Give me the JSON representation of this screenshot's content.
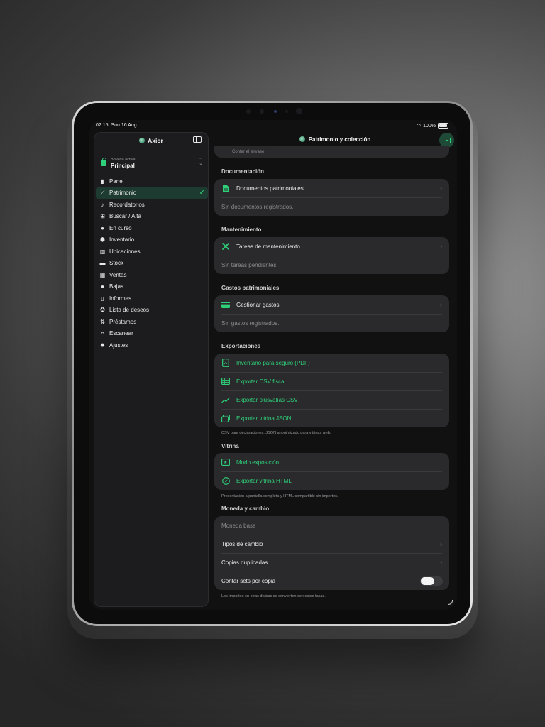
{
  "status": {
    "time": "02:15",
    "date": "Sun 16 Aug",
    "battery": "100%"
  },
  "sidebar": {
    "title": "Axior",
    "vault_label": "Bóveda activa",
    "vault_name": "Principal",
    "items": [
      {
        "label": "Panel",
        "icon": "chart-bar-icon"
      },
      {
        "label": "Patrimonio",
        "icon": "line-chart-icon",
        "active": true
      },
      {
        "label": "Recordatorios",
        "icon": "bell-icon"
      },
      {
        "label": "Buscar / Alta",
        "icon": "grid-icon"
      },
      {
        "label": "En curso",
        "icon": "progress-circle-icon"
      },
      {
        "label": "Inventario",
        "icon": "cube-icon"
      },
      {
        "label": "Ubicaciones",
        "icon": "map-icon"
      },
      {
        "label": "Stock",
        "icon": "archive-box-icon"
      },
      {
        "label": "Ventas",
        "icon": "barcode-icon"
      },
      {
        "label": "Bajas",
        "icon": "coin-icon"
      },
      {
        "label": "Informes",
        "icon": "document-icon"
      },
      {
        "label": "Lista de deseos",
        "icon": "star-circle-icon"
      },
      {
        "label": "Préstamos",
        "icon": "arrows-icon"
      },
      {
        "label": "Escanear",
        "icon": "scan-icon"
      },
      {
        "label": "Ajustes",
        "icon": "gear-icon"
      }
    ]
  },
  "main": {
    "title": "Patrimonio y colección",
    "partial_row": "Contar el envase",
    "sections": {
      "documentacion": {
        "title": "Documentación",
        "row": "Documentos patrimoniales",
        "empty": "Sin documentos registrados."
      },
      "mantenimiento": {
        "title": "Mantenimiento",
        "row": "Tareas de mantenimiento",
        "empty": "Sin tareas pendientes."
      },
      "gastos": {
        "title": "Gastos patrimoniales",
        "row": "Gestionar gastos",
        "empty": "Sin gastos registrados."
      },
      "exportaciones": {
        "title": "Exportaciones",
        "rows": [
          "Inventario para seguro (PDF)",
          "Exportar CSV fiscal",
          "Exportar plusvalías CSV",
          "Exportar vitrina JSON"
        ],
        "footer": "CSV para declaraciones; JSON anonimizado para vitrinas web."
      },
      "vitrina": {
        "title": "Vitrina",
        "rows": [
          "Modo exposición",
          "Exportar vitrina HTML"
        ],
        "footer": "Presentación a pantalla completa y HTML compartible sin importes."
      },
      "moneda": {
        "title": "Moneda y cambio",
        "base": "Moneda base",
        "rows": [
          "Tipos de cambio",
          "Copias duplicadas"
        ],
        "toggle_label": "Contar sets por copia",
        "toggle_on": false,
        "footer": "Los importes en otras divisas se convierten con estas tasas."
      }
    }
  },
  "colors": {
    "accent": "#2fd07a",
    "card": "#2a2a2c",
    "background": "#111111"
  }
}
